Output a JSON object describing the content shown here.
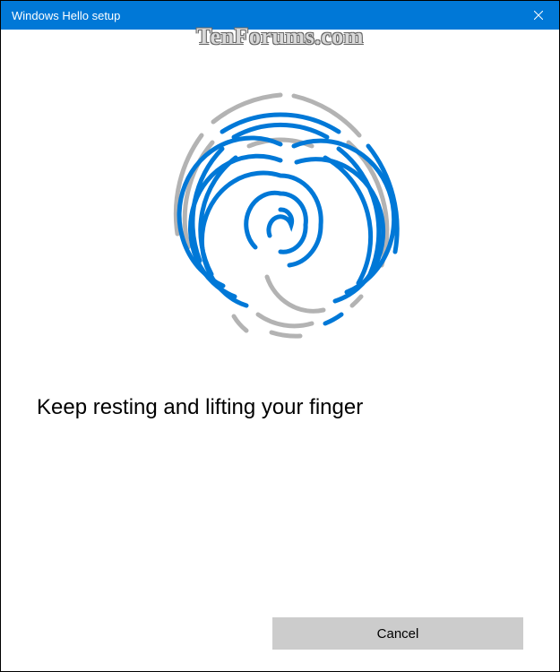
{
  "titlebar": {
    "title": "Windows Hello setup"
  },
  "main": {
    "instruction": "Keep resting and lifting your finger"
  },
  "footer": {
    "cancel_label": "Cancel"
  },
  "watermark": {
    "text": "TenForums.com"
  },
  "colors": {
    "accent": "#0078d7",
    "ridge_active": "#0078d7",
    "ridge_inactive": "#b3b3b3",
    "button_bg": "#cccccc"
  }
}
